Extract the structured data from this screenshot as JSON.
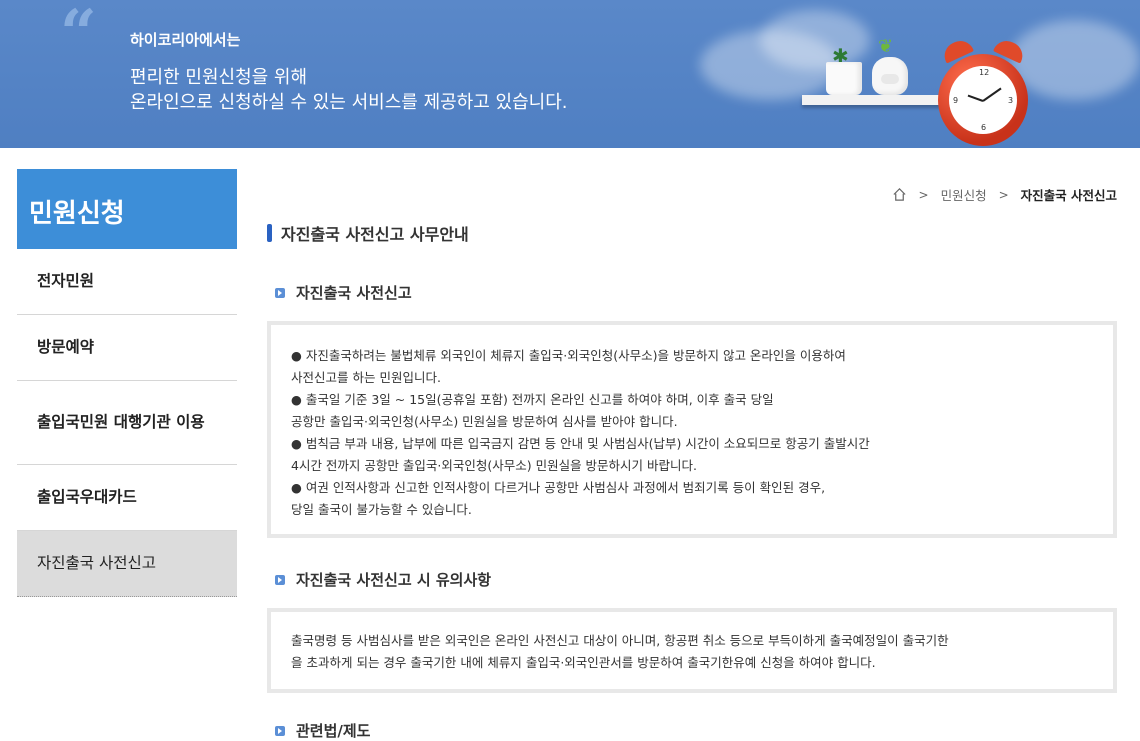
{
  "banner": {
    "small_title": "하이코리아에서는",
    "line1": "편리한 민원신청을 위해",
    "line2": "온라인으로 신청하실 수 있는 서비스를 제공하고 있습니다."
  },
  "sidebar": {
    "title": "민원신청",
    "items": [
      {
        "label": "전자민원"
      },
      {
        "label": "방문예약"
      },
      {
        "label": "출입국민원 대행기관 이용"
      },
      {
        "label": "출입국우대카드"
      },
      {
        "label": "자진출국 사전신고"
      }
    ]
  },
  "breadcrumb": {
    "home_icon": "home-icon",
    "items": [
      "민원신청",
      "자진출국 사전신고"
    ]
  },
  "page_title": "자진출국 사전신고 사무안내",
  "sections": [
    {
      "heading": "자진출국 사전신고",
      "lines": [
        "● 자진출국하려는 불법체류 외국인이 체류지 출입국·외국인청(사무소)을 방문하지 않고 온라인을 이용하여",
        "사전신고를 하는 민원입니다.",
        "● 출국일 기준 3일 ~ 15일(공휴일 포함) 전까지 온라인 신고를 하여야 하며, 이후 출국 당일",
        "공항만 출입국·외국인청(사무소) 민원실을 방문하여 심사를 받아야 합니다.",
        "● 범칙금 부과 내용, 납부에 따른 입국금지 감면 등 안내 및 사범심사(납부) 시간이 소요되므로 항공기 출발시간",
        "4시간 전까지 공항만 출입국·외국인청(사무소) 민원실을 방문하시기 바랍니다.",
        "● 여권 인적사항과 신고한 인적사항이 다르거나 공항만 사범심사 과정에서 범죄기록 등이 확인된 경우,",
        "당일 출국이 불가능할 수 있습니다."
      ]
    },
    {
      "heading": "자진출국 사전신고 시 유의사항",
      "lines": [
        "출국명령 등 사범심사를 받은 외국인은 온라인 사전신고 대상이 아니며, 항공편 취소 등으로 부득이하게 출국예정일이 출국기한",
        "을 초과하게 되는 경우 출국기한 내에 체류지 출입국·외국인관서를 방문하여 출국기한유예 신청을 하여야 합니다."
      ]
    },
    {
      "heading": "관련법/제도"
    }
  ],
  "colors": {
    "banner_bg": "#5283c6",
    "sidebar_header": "#3d8ed8",
    "title_bar": "#2a62c2",
    "active_item_bg": "#dcdcdc"
  }
}
